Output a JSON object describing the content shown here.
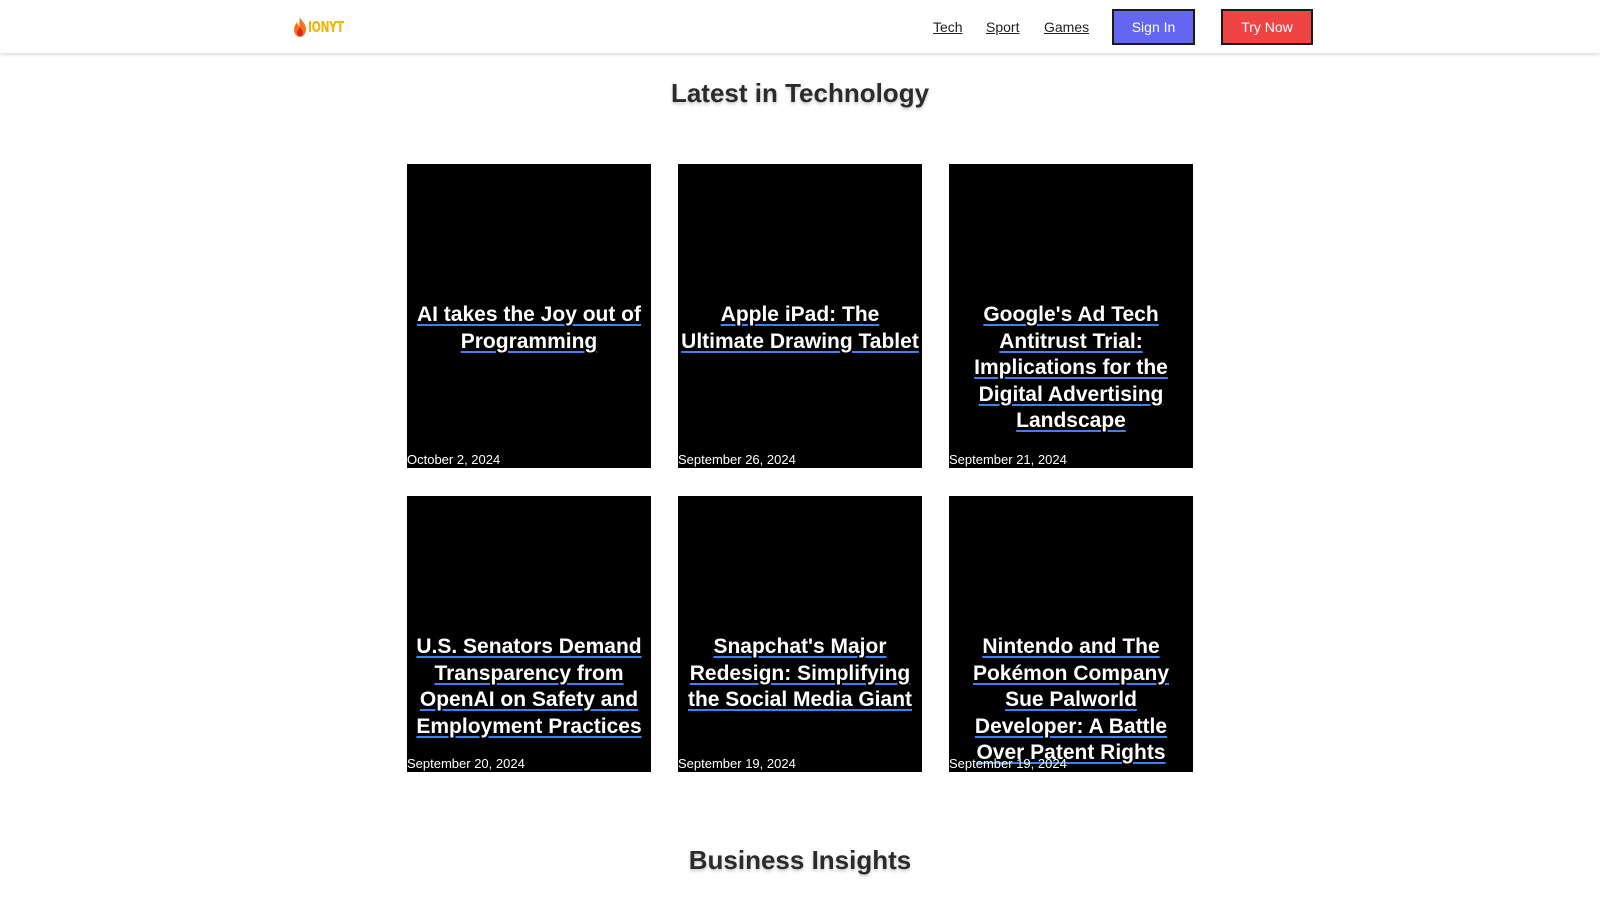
{
  "header": {
    "logo_text": "IONYT",
    "nav": [
      {
        "label": "Tech"
      },
      {
        "label": "Sport"
      },
      {
        "label": "Games"
      }
    ],
    "signin_label": "Sign In",
    "try_label": "Try Now"
  },
  "sections": {
    "tech_title": "Latest in Technology",
    "business_title": "Business Insights"
  },
  "articles": [
    {
      "title": "AI takes the Joy out of Programming",
      "date": "October 2, 2024"
    },
    {
      "title": "Apple iPad: The Ultimate Drawing Tablet",
      "date": "September 26, 2024"
    },
    {
      "title": "Google's Ad Tech Antitrust Trial: Implications for the Digital Advertising Landscape",
      "date": "September 21, 2024"
    },
    {
      "title": "U.S. Senators Demand Transparency from OpenAI on Safety and Employment Practices",
      "date": "September 20, 2024"
    },
    {
      "title": "Snapchat's Major Redesign: Simplifying the Social Media Giant",
      "date": "September 19, 2024"
    },
    {
      "title": "Nintendo and The Pokémon Company Sue Palworld Developer: A Battle Over Patent Rights",
      "date": "September 19, 2024"
    }
  ],
  "colors": {
    "signin_bg": "#6366f1",
    "try_bg": "#ef4444",
    "logo": "#f5b400",
    "card_bg": "#000000",
    "title_underline": "#3b82f6"
  },
  "icons": {
    "logo": "flame-icon"
  }
}
